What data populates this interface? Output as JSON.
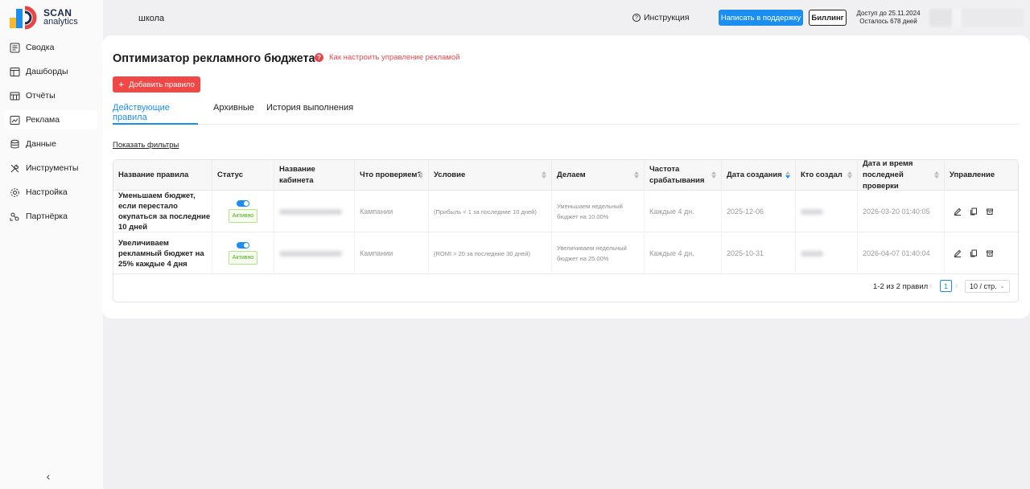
{
  "app": {
    "logo_line1": "SCAN",
    "logo_line2": "analytics",
    "colors": {
      "accent": "#1a8ff0",
      "danger": "#f04747",
      "success": "#52a02c"
    }
  },
  "sidebar": {
    "items": [
      {
        "label": "Сводка",
        "icon": "summary-icon"
      },
      {
        "label": "Дашборды",
        "icon": "dashboard-icon"
      },
      {
        "label": "Отчёты",
        "icon": "reports-icon"
      },
      {
        "label": "Реклама",
        "icon": "ads-icon",
        "active": true
      },
      {
        "label": "Данные",
        "icon": "database-icon"
      },
      {
        "label": "Инструменты",
        "icon": "tools-icon"
      },
      {
        "label": "Настройка",
        "icon": "settings-icon"
      },
      {
        "label": "Партнёрка",
        "icon": "partners-icon"
      }
    ],
    "collapse": "‹"
  },
  "header": {
    "workspace": "школа",
    "help": "Инструкция",
    "support_button": "Написать в поддержку",
    "billing_button": "Биллинг",
    "access_line1": "Доступ до 25.11.2024",
    "access_line2": "Осталось 678 дней"
  },
  "page": {
    "title": "Оптимизатор рекламного бюджета",
    "help_link": "Как настроить управление рекламой",
    "add_button": "Добавить правило",
    "tabs": [
      "Действующие правила",
      "Архивные",
      "История выполнения"
    ],
    "filters_link": "Показать фильтры"
  },
  "table": {
    "columns": [
      "Название правила",
      "Статус",
      "Название кабинета",
      "Что проверяем?",
      "Условие",
      "Делаем",
      "Частота срабатывания",
      "Дата создания",
      "Кто создал",
      "Дата и время последней проверки",
      "Управление"
    ],
    "rows": [
      {
        "name": "Уменьшаем бюджет, если перестало окупаться за последние 10 дней",
        "status": "Активно",
        "check": "Кампании",
        "condition": "(Прибыль < 1 за последние 10 дней)",
        "action": "Уменьшаем недельный бюджет на 10.00%",
        "frequency": "Каждые 4 дн.",
        "created": "2025-12-06",
        "last_check": "2026-03-20 01:40:05"
      },
      {
        "name": "Увеличиваем рекламный бюджет на 25% каждые 4 дня",
        "status": "Активно",
        "check": "Кампании",
        "condition": "(ROMI > 20 за последние 30 дней)",
        "action": "Увеличиваем недельный бюджет на 25.00%",
        "frequency": "Каждые 4 дн.",
        "created": "2025-10-31",
        "last_check": "2026-04-07 01:40:04"
      }
    ]
  },
  "pagination": {
    "total": "1-2 из 2 правил",
    "current_page": "1",
    "page_size": "10 / стр."
  }
}
